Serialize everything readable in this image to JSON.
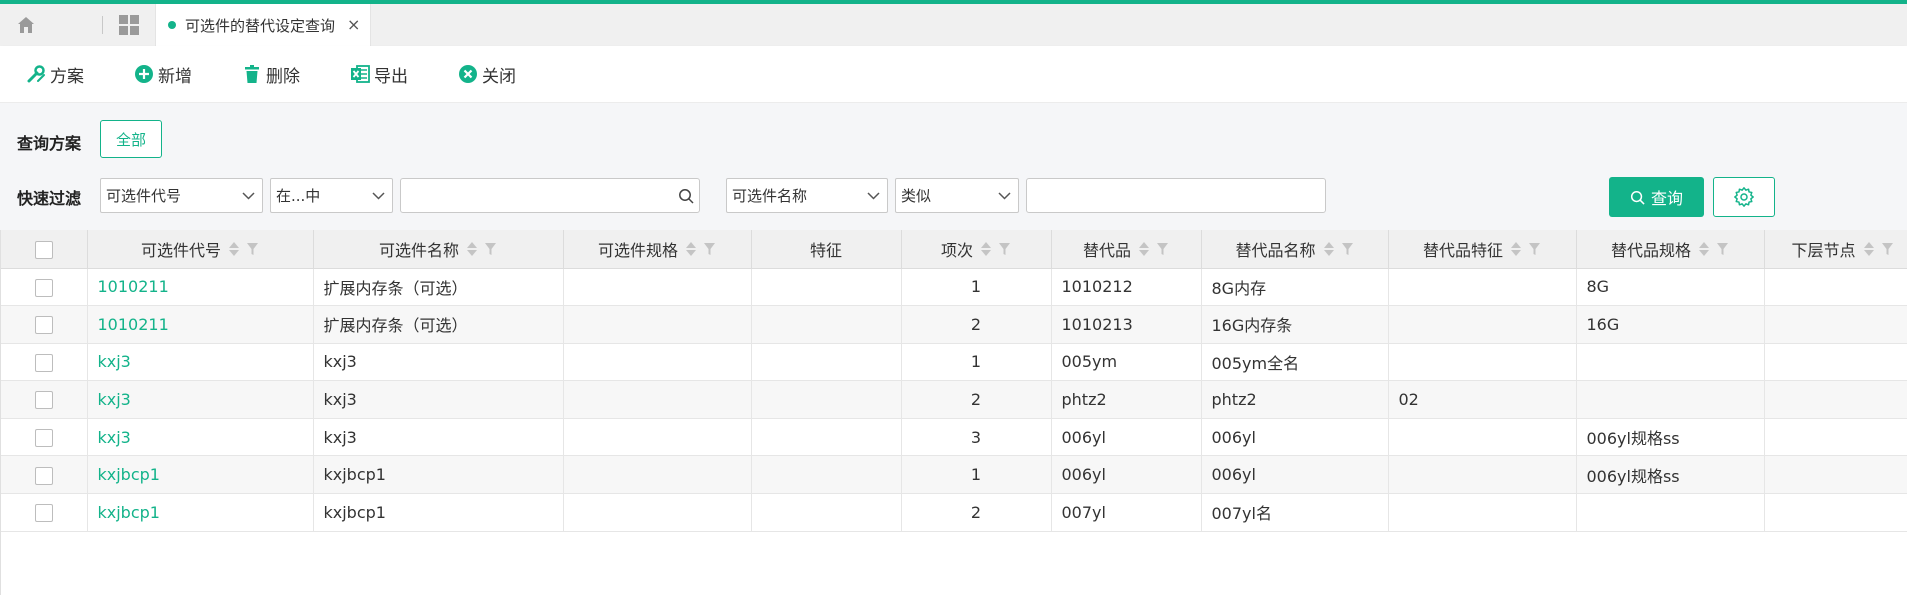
{
  "tabs": {
    "active_label": "可选件的替代设定查询",
    "close_glyph": "×"
  },
  "toolbar": {
    "scheme": "方案",
    "add": "新增",
    "delete": "删除",
    "export": "导出",
    "close": "关闭"
  },
  "filter": {
    "scheme_label": "查询方案",
    "scheme_all": "全部",
    "quick_label": "快速过滤",
    "field1": "可选件代号",
    "op1": "在...中",
    "value1": "",
    "field2": "可选件名称",
    "op2": "类似",
    "value2": "",
    "query_button": "查询"
  },
  "table": {
    "headers": [
      "可选件代号",
      "可选件名称",
      "可选件规格",
      "特征",
      "项次",
      "替代品",
      "替代品名称",
      "替代品特征",
      "替代品规格",
      "下层节点"
    ],
    "rows": [
      [
        "1010211",
        "扩展内存条（可选）",
        "",
        "",
        "1",
        "1010212",
        "8G内存",
        "",
        "8G",
        ""
      ],
      [
        "1010211",
        "扩展内存条（可选）",
        "",
        "",
        "2",
        "1010213",
        "16G内存条",
        "",
        "16G",
        ""
      ],
      [
        "kxj3",
        "kxj3",
        "",
        "",
        "1",
        "005ym",
        "005ym全名",
        "",
        "",
        ""
      ],
      [
        "kxj3",
        "kxj3",
        "",
        "",
        "2",
        "phtz2",
        "phtz2",
        "02",
        "",
        ""
      ],
      [
        "kxj3",
        "kxj3",
        "",
        "",
        "3",
        "006yl",
        "006yl",
        "",
        "006yl规格ss",
        ""
      ],
      [
        "kxjbcp1",
        "kxjbcp1",
        "",
        "",
        "1",
        "006yl",
        "006yl",
        "",
        "006yl规格ss",
        ""
      ],
      [
        "kxjbcp1",
        "kxjbcp1",
        "",
        "",
        "2",
        "007yl",
        "007yl名",
        "",
        "",
        ""
      ]
    ]
  },
  "colors": {
    "accent": "#13b38a",
    "toolbar_icon": "#13b38a",
    "header_bg": "#f0f0f0"
  },
  "icons": {
    "home": "home-icon",
    "apps": "grid-icon",
    "scheme": "wrench-icon",
    "add": "plus-circle-icon",
    "delete": "trash-icon",
    "export": "excel-icon",
    "close": "x-circle-icon",
    "search": "search-icon",
    "settings": "gear-icon"
  }
}
